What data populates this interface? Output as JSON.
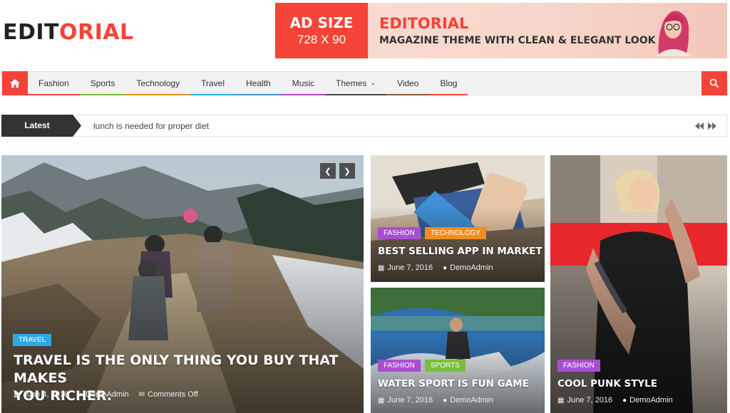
{
  "logo": {
    "part1": "EDIT",
    "part2": "ORIAL"
  },
  "ad": {
    "size_label": "AD SIZE",
    "dimensions": "728 X 90",
    "brand": "EDITORIAL",
    "tagline": "MAGAZINE THEME WITH CLEAN & ELEGANT LOOK"
  },
  "nav": {
    "items": [
      {
        "label": "Fashion",
        "color": "#e8463d"
      },
      {
        "label": "Sports",
        "color": "#7bbd3f"
      },
      {
        "label": "Technology",
        "color": "#f28c1e"
      },
      {
        "label": "Travel",
        "color": "#2fa9e1"
      },
      {
        "label": "Health",
        "color": "#4f8fc9"
      },
      {
        "label": "Music",
        "color": "#b24abf"
      },
      {
        "label": "Themes",
        "color": "#4a4a4a"
      },
      {
        "label": "Video",
        "color": "#8a5a3a"
      },
      {
        "label": "Blog",
        "color": "#f54337"
      }
    ]
  },
  "ticker": {
    "label": "Latest",
    "text": "lunch is needed for proper diet"
  },
  "featured": {
    "category": "TRAVEL",
    "title_line1": "TRAVEL IS THE ONLY THING YOU BUY THAT MAKES",
    "title_line2": "YOU RICHER.",
    "date": "June 4, 2016",
    "author": "DemoAdmin",
    "comments": "Comments Off"
  },
  "card_app": {
    "categories": [
      "FASHION",
      "TECHNOLOGY"
    ],
    "title": "BEST SELLING APP IN MARKET",
    "date": "June 7, 2016",
    "author": "DemoAdmin"
  },
  "card_water": {
    "categories": [
      "FASHION",
      "SPORTS"
    ],
    "title": "WATER SPORT IS FUN GAME",
    "date": "June 7, 2016",
    "author": "DemoAdmin"
  },
  "card_punk": {
    "categories": [
      "FASHION"
    ],
    "title": "COOL PUNK STYLE",
    "date": "June 7, 2016",
    "author": "DemoAdmin"
  },
  "colors": {
    "accent": "#f54337",
    "cat_travel": "#2fa9e1",
    "cat_fashion": "#a94ed0",
    "cat_technology": "#f28c1e",
    "cat_sports": "#7bbd3f",
    "latest_bg": "#333333"
  },
  "icons": [
    "home-icon",
    "search-icon",
    "calendar-icon",
    "user-icon",
    "comment-icon",
    "chevron-left-icon",
    "chevron-right-icon"
  ]
}
